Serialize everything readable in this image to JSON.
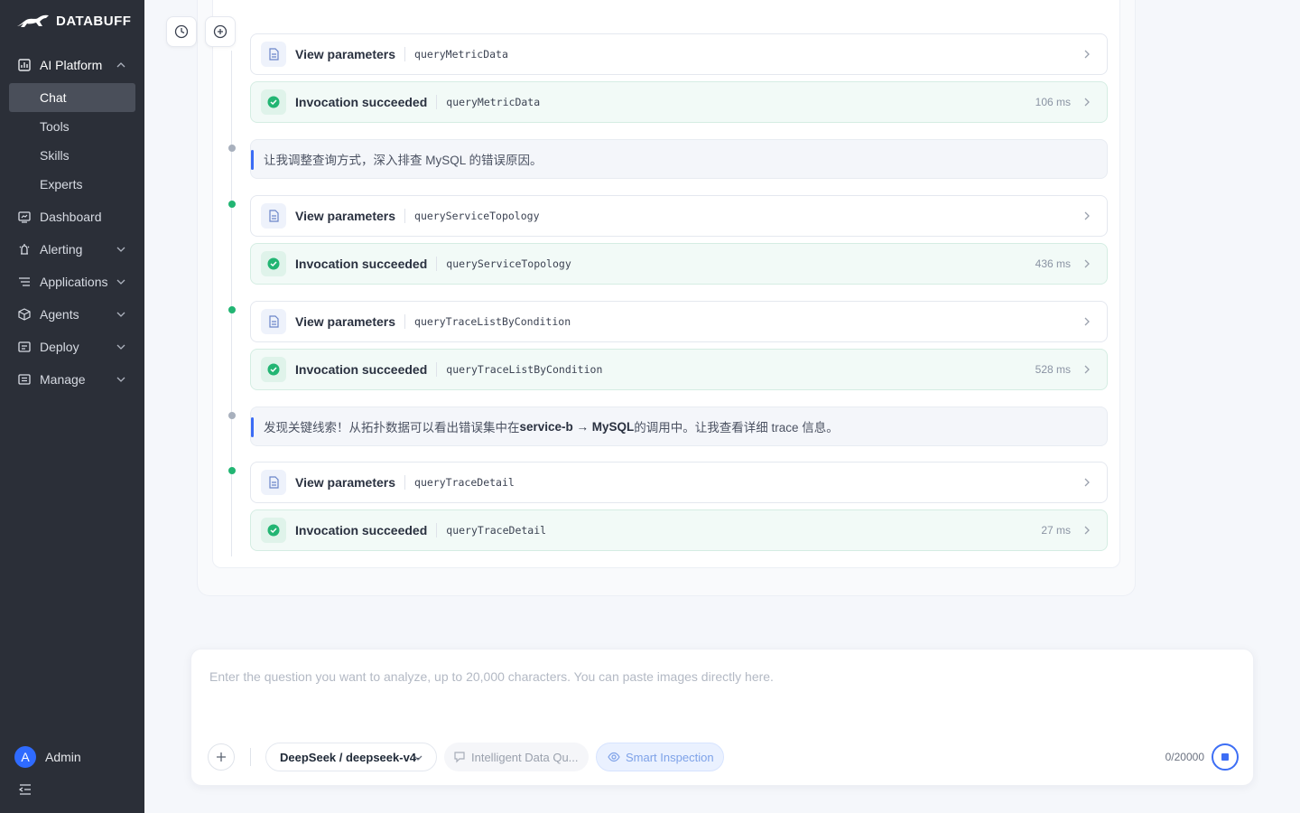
{
  "brand": {
    "name": "DATABUFF"
  },
  "sidebar": {
    "sections": [
      {
        "label": "AI Platform",
        "icon": "ai-platform-icon"
      },
      {
        "label": "Dashboard",
        "icon": "dashboard-icon"
      },
      {
        "label": "Alerting",
        "icon": "alerting-icon"
      },
      {
        "label": "Applications",
        "icon": "applications-icon"
      },
      {
        "label": "Agents",
        "icon": "agents-icon"
      },
      {
        "label": "Deploy",
        "icon": "deploy-icon"
      },
      {
        "label": "Manage",
        "icon": "manage-icon"
      }
    ],
    "sub_items": [
      {
        "label": "Chat",
        "active": true
      },
      {
        "label": "Tools"
      },
      {
        "label": "Skills"
      },
      {
        "label": "Experts"
      }
    ],
    "user": {
      "avatar_letter": "A",
      "name": "Admin"
    }
  },
  "timeline": {
    "params_label": "View parameters",
    "success_label": "Invocation succeeded",
    "calls": [
      {
        "function": "queryMetricData",
        "time": "106 ms"
      },
      {
        "function": "queryServiceTopology",
        "time": "436 ms"
      },
      {
        "function": "queryTraceListByCondition",
        "time": "528 ms"
      },
      {
        "function": "queryTraceDetail",
        "time": "27 ms"
      }
    ],
    "messages": [
      {
        "text": "让我调整查询方式，深入排查 MySQL 的错误原因。"
      },
      {
        "prefix": "发现关键线索！从拓扑数据可以看出错误集中在 ",
        "bold": "service-b → MySQL",
        "suffix": " 的调用中。让我查看详细 trace 信息。"
      }
    ]
  },
  "composer": {
    "placeholder": "Enter the question you want to analyze, up to 20,000 characters. You can paste images directly here.",
    "model": "DeepSeek / deepseek-v4-",
    "intelligent_data_query": "Intelligent Data Qu...",
    "smart_inspection": "Smart Inspection",
    "counter": "0/20000"
  },
  "colors": {
    "sidebar_bg": "#2b2f38",
    "accent": "#3d6ef5",
    "success": "#22b573"
  }
}
